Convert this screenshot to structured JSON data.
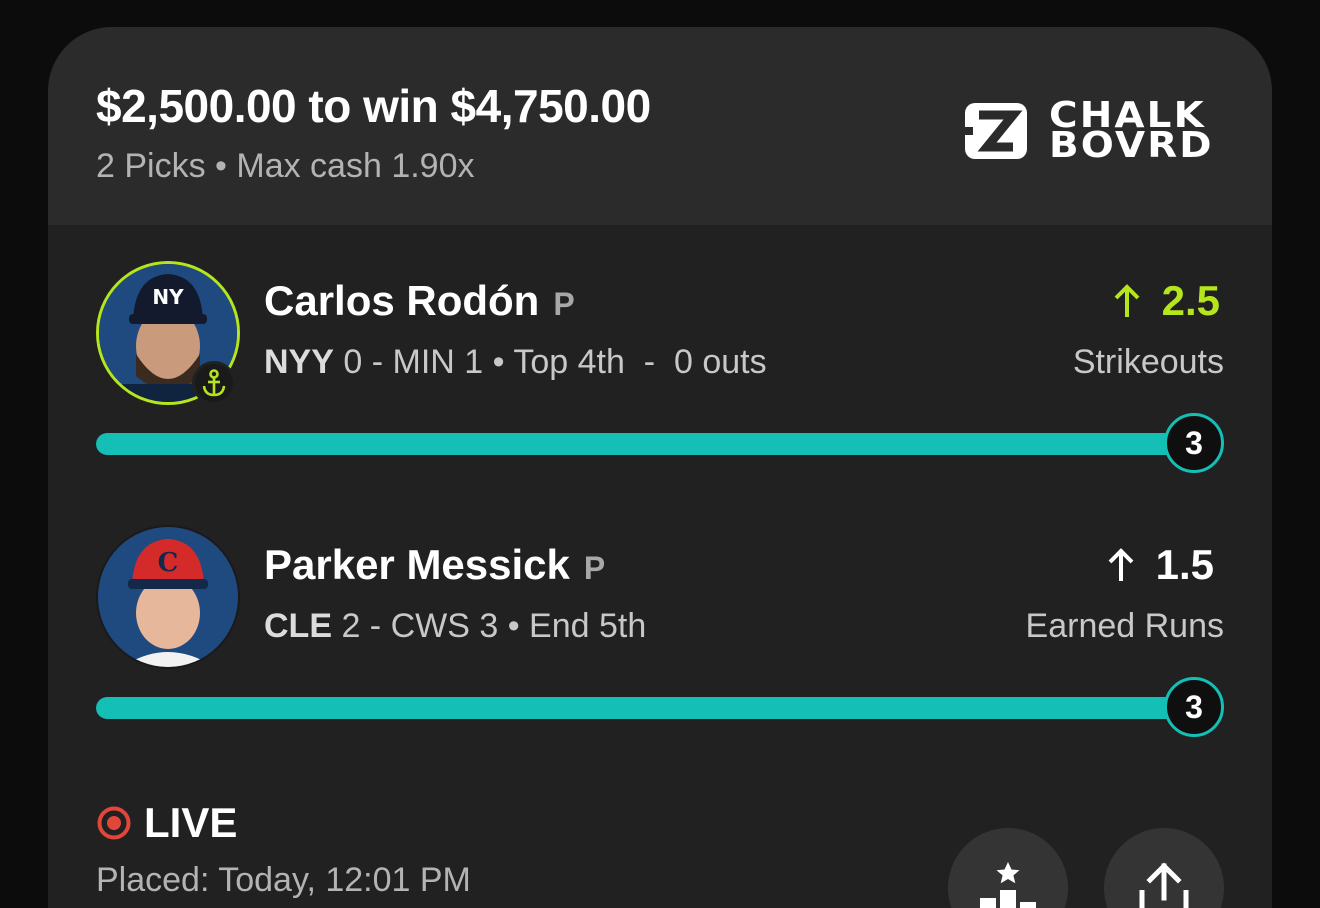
{
  "header": {
    "wager_title": "$2,500.00 to win $4,750.00",
    "wager_subtitle": "2 Picks • Max cash 1.90x",
    "brand_line1": "CHALK",
    "brand_line2": "BOVRD"
  },
  "picks": [
    {
      "player": "Carlos Rodón",
      "position": "P",
      "team": "NYY",
      "score_rest": " 0 - MIN 1 • Top 4th  -  0 outs",
      "direction_icon": "arrow-up-icon",
      "line": "2.5",
      "line_color": "#b5e61d",
      "stat": "Strikeouts",
      "current_value": "3",
      "progress_fraction": 1.0,
      "anchor_badge": "anchor-icon"
    },
    {
      "player": "Parker Messick",
      "position": "P",
      "team": "CLE",
      "score_rest": " 2 - CWS 3 • End 5th",
      "direction_icon": "arrow-up-icon",
      "line": "1.5",
      "line_color": "#ffffff",
      "stat": "Earned Runs",
      "current_value": "3",
      "progress_fraction": 1.0
    }
  ],
  "footer": {
    "status": "LIVE",
    "status_color": "#e0463a",
    "placed": "Placed: Today, 12:01 PM",
    "buttons": [
      "leaderboard-icon",
      "share-icon"
    ]
  },
  "colors": {
    "progress": "#14bfb5",
    "accent_green": "#b5e61d",
    "card_bg": "#212121",
    "header_bg": "#2b2b2b"
  }
}
